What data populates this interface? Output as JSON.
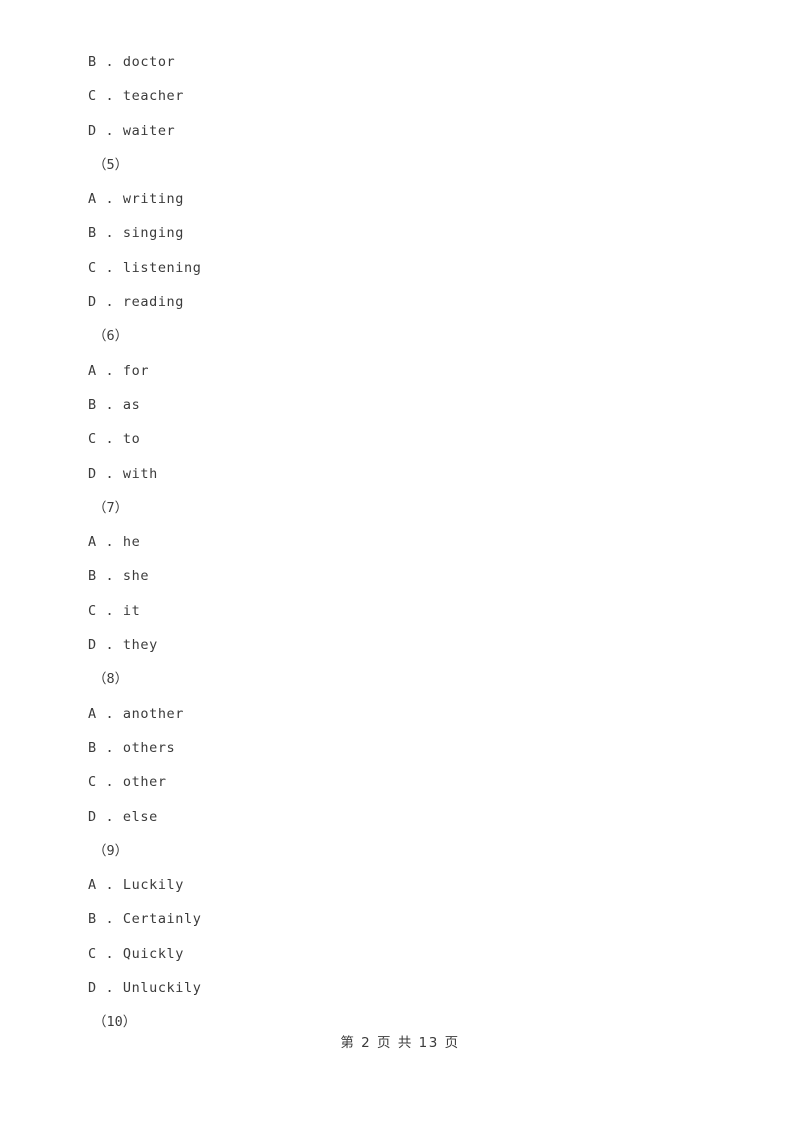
{
  "document": {
    "page_background": "#ffffff",
    "text_color": "#3b3b3b",
    "blocks": [
      {
        "type": "option",
        "letter": "B",
        "separator": " . ",
        "text": "doctor"
      },
      {
        "type": "option",
        "letter": "C",
        "separator": " . ",
        "text": "teacher"
      },
      {
        "type": "option",
        "letter": "D",
        "separator": " . ",
        "text": "waiter"
      },
      {
        "type": "question",
        "label": "（5）"
      },
      {
        "type": "option",
        "letter": "A",
        "separator": " . ",
        "text": "writing"
      },
      {
        "type": "option",
        "letter": "B",
        "separator": " . ",
        "text": "singing"
      },
      {
        "type": "option",
        "letter": "C",
        "separator": " . ",
        "text": "listening"
      },
      {
        "type": "option",
        "letter": "D",
        "separator": " . ",
        "text": "reading"
      },
      {
        "type": "question",
        "label": "（6）"
      },
      {
        "type": "option",
        "letter": "A",
        "separator": " . ",
        "text": "for"
      },
      {
        "type": "option",
        "letter": "B",
        "separator": " . ",
        "text": "as"
      },
      {
        "type": "option",
        "letter": "C",
        "separator": " . ",
        "text": "to"
      },
      {
        "type": "option",
        "letter": "D",
        "separator": " . ",
        "text": "with"
      },
      {
        "type": "question",
        "label": "（7）"
      },
      {
        "type": "option",
        "letter": "A",
        "separator": " . ",
        "text": "he"
      },
      {
        "type": "option",
        "letter": "B",
        "separator": " . ",
        "text": "she"
      },
      {
        "type": "option",
        "letter": "C",
        "separator": " . ",
        "text": "it"
      },
      {
        "type": "option",
        "letter": "D",
        "separator": " . ",
        "text": "they"
      },
      {
        "type": "question",
        "label": "（8）"
      },
      {
        "type": "option",
        "letter": "A",
        "separator": " . ",
        "text": "another"
      },
      {
        "type": "option",
        "letter": "B",
        "separator": " . ",
        "text": "others"
      },
      {
        "type": "option",
        "letter": "C",
        "separator": " . ",
        "text": "other"
      },
      {
        "type": "option",
        "letter": "D",
        "separator": " . ",
        "text": "else"
      },
      {
        "type": "question",
        "label": "（9）"
      },
      {
        "type": "option",
        "letter": "A",
        "separator": " . ",
        "text": "Luckily"
      },
      {
        "type": "option",
        "letter": "B",
        "separator": " . ",
        "text": "Certainly"
      },
      {
        "type": "option",
        "letter": "C",
        "separator": " . ",
        "text": "Quickly"
      },
      {
        "type": "option",
        "letter": "D",
        "separator": " . ",
        "text": "Unluckily"
      },
      {
        "type": "question",
        "label": "（10）"
      }
    ]
  },
  "footer": {
    "text": "第 2 页 共 13 页",
    "current_page": "2",
    "total_pages": "13"
  }
}
